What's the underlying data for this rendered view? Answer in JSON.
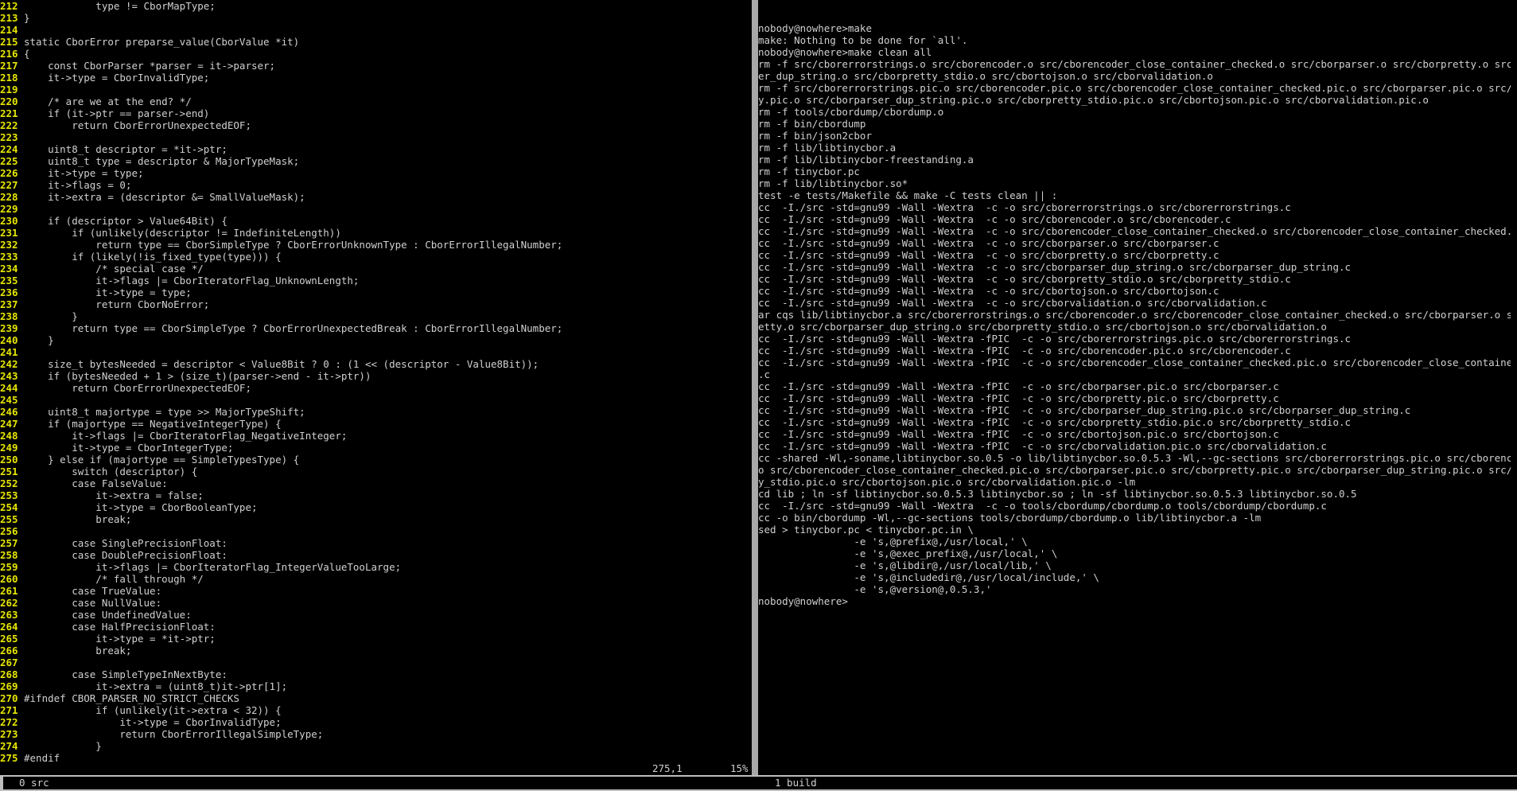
{
  "editor": {
    "lines": [
      {
        "n": "212",
        "t": "            type != CborMapType;"
      },
      {
        "n": "213",
        "t": "}"
      },
      {
        "n": "214",
        "t": ""
      },
      {
        "n": "215",
        "t": "static CborError preparse_value(CborValue *it)"
      },
      {
        "n": "216",
        "t": "{"
      },
      {
        "n": "217",
        "t": "    const CborParser *parser = it->parser;"
      },
      {
        "n": "218",
        "t": "    it->type = CborInvalidType;"
      },
      {
        "n": "219",
        "t": ""
      },
      {
        "n": "220",
        "t": "    /* are we at the end? */"
      },
      {
        "n": "221",
        "t": "    if (it->ptr == parser->end)"
      },
      {
        "n": "222",
        "t": "        return CborErrorUnexpectedEOF;"
      },
      {
        "n": "223",
        "t": ""
      },
      {
        "n": "224",
        "t": "    uint8_t descriptor = *it->ptr;"
      },
      {
        "n": "225",
        "t": "    uint8_t type = descriptor & MajorTypeMask;"
      },
      {
        "n": "226",
        "t": "    it->type = type;"
      },
      {
        "n": "227",
        "t": "    it->flags = 0;"
      },
      {
        "n": "228",
        "t": "    it->extra = (descriptor &= SmallValueMask);"
      },
      {
        "n": "229",
        "t": ""
      },
      {
        "n": "230",
        "t": "    if (descriptor > Value64Bit) {"
      },
      {
        "n": "231",
        "t": "        if (unlikely(descriptor != IndefiniteLength))"
      },
      {
        "n": "232",
        "t": "            return type == CborSimpleType ? CborErrorUnknownType : CborErrorIllegalNumber;"
      },
      {
        "n": "233",
        "t": "        if (likely(!is_fixed_type(type))) {"
      },
      {
        "n": "234",
        "t": "            /* special case */"
      },
      {
        "n": "235",
        "t": "            it->flags |= CborIteratorFlag_UnknownLength;"
      },
      {
        "n": "236",
        "t": "            it->type = type;"
      },
      {
        "n": "237",
        "t": "            return CborNoError;"
      },
      {
        "n": "238",
        "t": "        }"
      },
      {
        "n": "239",
        "t": "        return type == CborSimpleType ? CborErrorUnexpectedBreak : CborErrorIllegalNumber;"
      },
      {
        "n": "240",
        "t": "    }"
      },
      {
        "n": "241",
        "t": ""
      },
      {
        "n": "242",
        "t": "    size_t bytesNeeded = descriptor < Value8Bit ? 0 : (1 << (descriptor - Value8Bit));"
      },
      {
        "n": "243",
        "t": "    if (bytesNeeded + 1 > (size_t)(parser->end - it->ptr))"
      },
      {
        "n": "244",
        "t": "        return CborErrorUnexpectedEOF;"
      },
      {
        "n": "245",
        "t": ""
      },
      {
        "n": "246",
        "t": "    uint8_t majortype = type >> MajorTypeShift;"
      },
      {
        "n": "247",
        "t": "    if (majortype == NegativeIntegerType) {"
      },
      {
        "n": "248",
        "t": "        it->flags |= CborIteratorFlag_NegativeInteger;"
      },
      {
        "n": "249",
        "t": "        it->type = CborIntegerType;"
      },
      {
        "n": "250",
        "t": "    } else if (majortype == SimpleTypesType) {"
      },
      {
        "n": "251",
        "t": "        switch (descriptor) {"
      },
      {
        "n": "252",
        "t": "        case FalseValue:"
      },
      {
        "n": "253",
        "t": "            it->extra = false;"
      },
      {
        "n": "254",
        "t": "            it->type = CborBooleanType;"
      },
      {
        "n": "255",
        "t": "            break;"
      },
      {
        "n": "256",
        "t": ""
      },
      {
        "n": "257",
        "t": "        case SinglePrecisionFloat:"
      },
      {
        "n": "258",
        "t": "        case DoublePrecisionFloat:"
      },
      {
        "n": "259",
        "t": "            it->flags |= CborIteratorFlag_IntegerValueTooLarge;"
      },
      {
        "n": "260",
        "t": "            /* fall through */"
      },
      {
        "n": "261",
        "t": "        case TrueValue:"
      },
      {
        "n": "262",
        "t": "        case NullValue:"
      },
      {
        "n": "263",
        "t": "        case UndefinedValue:"
      },
      {
        "n": "264",
        "t": "        case HalfPrecisionFloat:"
      },
      {
        "n": "265",
        "t": "            it->type = *it->ptr;"
      },
      {
        "n": "266",
        "t": "            break;"
      },
      {
        "n": "267",
        "t": ""
      },
      {
        "n": "268",
        "t": "        case SimpleTypeInNextByte:"
      },
      {
        "n": "269",
        "t": "            it->extra = (uint8_t)it->ptr[1];"
      },
      {
        "n": "270",
        "t": "#ifndef CBOR_PARSER_NO_STRICT_CHECKS"
      },
      {
        "n": "271",
        "t": "            if (unlikely(it->extra < 32)) {"
      },
      {
        "n": "272",
        "t": "                it->type = CborInvalidType;"
      },
      {
        "n": "273",
        "t": "                return CborErrorIllegalSimpleType;"
      },
      {
        "n": "274",
        "t": "            }"
      },
      {
        "n": "275",
        "t": "#endif"
      }
    ],
    "cursor_position": "275,1",
    "scroll_percent": "15%"
  },
  "terminal": {
    "lines": [
      "nobody@nowhere>make",
      "make: Nothing to be done for `all'.",
      "nobody@nowhere>make clean all",
      "rm -f src/cborerrorstrings.o src/cborencoder.o src/cborencoder_close_container_checked.o src/cborparser.o src/cborpretty.o src/cborpars",
      "er_dup_string.o src/cborpretty_stdio.o src/cbortojson.o src/cborvalidation.o",
      "rm -f src/cborerrorstrings.pic.o src/cborencoder.pic.o src/cborencoder_close_container_checked.pic.o src/cborparser.pic.o src/cborprett",
      "y.pic.o src/cborparser_dup_string.pic.o src/cborpretty_stdio.pic.o src/cbortojson.pic.o src/cborvalidation.pic.o",
      "rm -f tools/cbordump/cbordump.o",
      "rm -f bin/cbordump",
      "rm -f bin/json2cbor",
      "rm -f lib/libtinycbor.a",
      "rm -f lib/libtinycbor-freestanding.a",
      "rm -f tinycbor.pc",
      "rm -f lib/libtinycbor.so*",
      "test -e tests/Makefile && make -C tests clean || :",
      "cc  -I./src -std=gnu99 -Wall -Wextra  -c -o src/cborerrorstrings.o src/cborerrorstrings.c",
      "cc  -I./src -std=gnu99 -Wall -Wextra  -c -o src/cborencoder.o src/cborencoder.c",
      "cc  -I./src -std=gnu99 -Wall -Wextra  -c -o src/cborencoder_close_container_checked.o src/cborencoder_close_container_checked.c",
      "cc  -I./src -std=gnu99 -Wall -Wextra  -c -o src/cborparser.o src/cborparser.c",
      "cc  -I./src -std=gnu99 -Wall -Wextra  -c -o src/cborpretty.o src/cborpretty.c",
      "cc  -I./src -std=gnu99 -Wall -Wextra  -c -o src/cborparser_dup_string.o src/cborparser_dup_string.c",
      "cc  -I./src -std=gnu99 -Wall -Wextra  -c -o src/cborpretty_stdio.o src/cborpretty_stdio.c",
      "cc  -I./src -std=gnu99 -Wall -Wextra  -c -o src/cbortojson.o src/cbortojson.c",
      "cc  -I./src -std=gnu99 -Wall -Wextra  -c -o src/cborvalidation.o src/cborvalidation.c",
      "ar cqs lib/libtinycbor.a src/cborerrorstrings.o src/cborencoder.o src/cborencoder_close_container_checked.o src/cborparser.o src/cborpr",
      "etty.o src/cborparser_dup_string.o src/cborpretty_stdio.o src/cbortojson.o src/cborvalidation.o",
      "cc  -I./src -std=gnu99 -Wall -Wextra -fPIC  -c -o src/cborerrorstrings.pic.o src/cborerrorstrings.c",
      "cc  -I./src -std=gnu99 -Wall -Wextra -fPIC  -c -o src/cborencoder.pic.o src/cborencoder.c",
      "cc  -I./src -std=gnu99 -Wall -Wextra -fPIC  -c -o src/cborencoder_close_container_checked.pic.o src/cborencoder_close_container_checked",
      ".c",
      "cc  -I./src -std=gnu99 -Wall -Wextra -fPIC  -c -o src/cborparser.pic.o src/cborparser.c",
      "cc  -I./src -std=gnu99 -Wall -Wextra -fPIC  -c -o src/cborpretty.pic.o src/cborpretty.c",
      "cc  -I./src -std=gnu99 -Wall -Wextra -fPIC  -c -o src/cborparser_dup_string.pic.o src/cborparser_dup_string.c",
      "cc  -I./src -std=gnu99 -Wall -Wextra -fPIC  -c -o src/cborpretty_stdio.pic.o src/cborpretty_stdio.c",
      "cc  -I./src -std=gnu99 -Wall -Wextra -fPIC  -c -o src/cbortojson.pic.o src/cbortojson.c",
      "cc  -I./src -std=gnu99 -Wall -Wextra -fPIC  -c -o src/cborvalidation.pic.o src/cborvalidation.c",
      "cc -shared -Wl,-soname,libtinycbor.so.0.5 -o lib/libtinycbor.so.0.5.3 -Wl,--gc-sections src/cborerrorstrings.pic.o src/cborencoder.pic.",
      "o src/cborencoder_close_container_checked.pic.o src/cborparser.pic.o src/cborpretty.pic.o src/cborparser_dup_string.pic.o src/cborpretti",
      "y_stdio.pic.o src/cbortojson.pic.o src/cborvalidation.pic.o -lm",
      "cd lib ; ln -sf libtinycbor.so.0.5.3 libtinycbor.so ; ln -sf libtinycbor.so.0.5.3 libtinycbor.so.0.5",
      "cc  -I./src -std=gnu99 -Wall -Wextra  -c -o tools/cbordump/cbordump.o tools/cbordump/cbordump.c",
      "cc -o bin/cbordump -Wl,--gc-sections tools/cbordump/cbordump.o lib/libtinycbor.a -lm",
      "sed > tinycbor.pc < tinycbor.pc.in \\",
      "                -e 's,@prefix@,/usr/local,' \\",
      "                -e 's,@exec_prefix@,/usr/local,' \\",
      "                -e 's,@libdir@,/usr/local/lib,' \\",
      "                -e 's,@includedir@,/usr/local/include,' \\",
      "                -e 's,@version@,0.5.3,'",
      "nobody@nowhere>"
    ]
  },
  "statusbar": {
    "tab0": "0 src",
    "tab1": "1 build"
  },
  "colors": {
    "background": "#000000",
    "line_number": "#e6e600",
    "divider": "#a8a8a8",
    "status_bar": "#bdbdbd"
  }
}
